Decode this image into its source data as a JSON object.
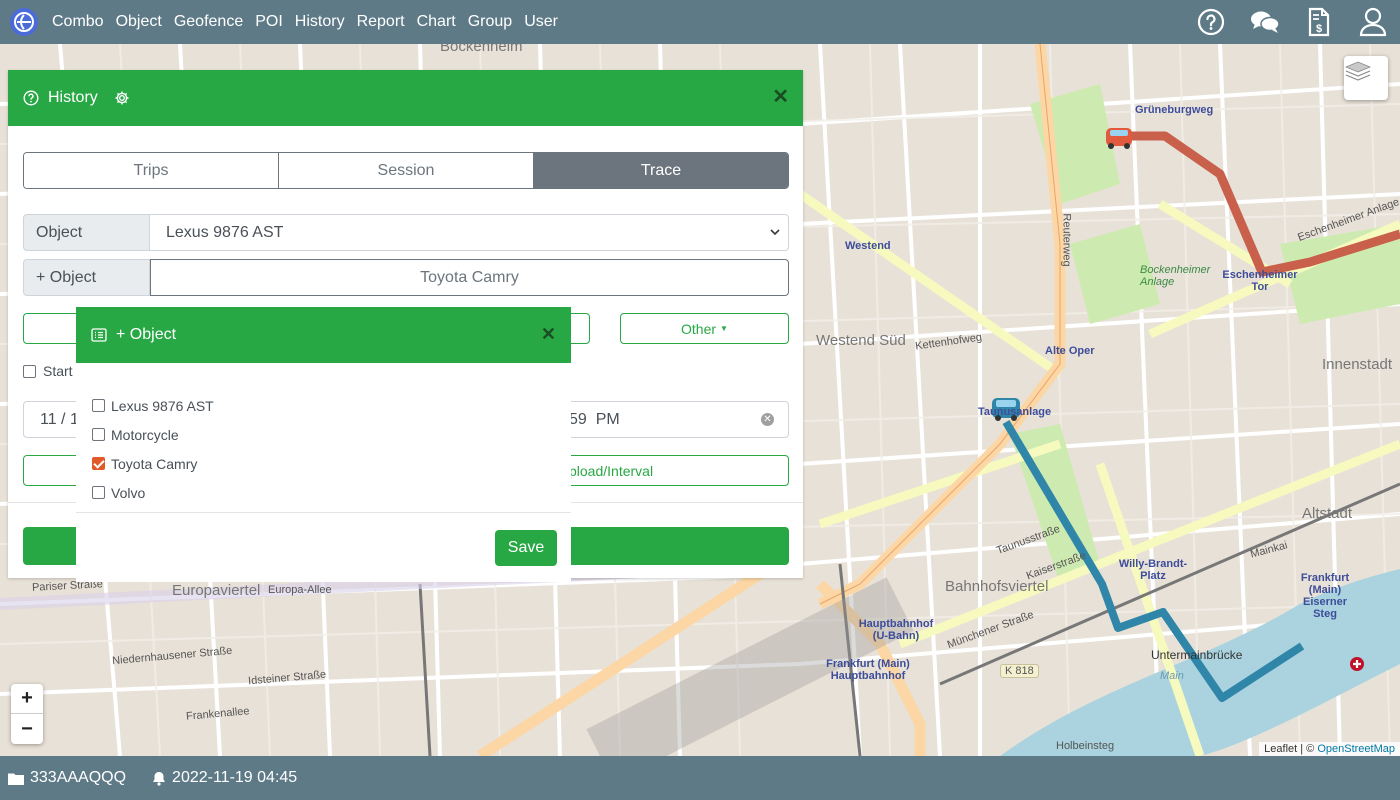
{
  "nav": {
    "items": [
      "Combo",
      "Object",
      "Geofence",
      "POI",
      "History",
      "Report",
      "Chart",
      "Group",
      "User"
    ],
    "icons": [
      "help-icon",
      "chat-icon",
      "invoice-icon",
      "user-icon"
    ]
  },
  "history_panel": {
    "title": "History",
    "tabs": [
      {
        "label": "Trips",
        "active": false
      },
      {
        "label": "Session",
        "active": false
      },
      {
        "label": "Trace",
        "active": true
      }
    ],
    "object_label": "Object",
    "object_value": "Lexus 9876 AST",
    "add_object_label": "+ Object",
    "add_object_value": "Toyota Camry",
    "other_button": "Other",
    "start_label": "Start",
    "start_date_partial": "11 / 1",
    "end_time_partial": "59  PM",
    "interval_button_partial": "pload/Interval"
  },
  "object_modal": {
    "title": "+ Object",
    "items": [
      {
        "label": "Lexus 9876 AST",
        "checked": false
      },
      {
        "label": "Motorcycle",
        "checked": false
      },
      {
        "label": "Toyota Camry",
        "checked": true
      },
      {
        "label": "Volvo",
        "checked": false
      }
    ],
    "save_label": "Save"
  },
  "map": {
    "zoom_in": "+",
    "zoom_out": "−",
    "attribution_prefix": "Leaflet | © ",
    "attribution_link": "OpenStreetMap",
    "track_colors": {
      "red_track": "#c9604c",
      "blue_track": "#2f86a8"
    },
    "labels": {
      "bockenheim": "Bockenheim",
      "westend": "Westend",
      "westend_sued": "Westend Süd",
      "alte_oper": "Alte Oper",
      "grueneburgweg": "Grüneburgweg",
      "eschenheimer_tor": "Eschenheimer Tor",
      "eschenheimer_anlage": "Eschenheimer Anlage",
      "bockenheimer_anlage": "Bockenheimer Anlage",
      "innenstadt": "Innenstadt",
      "altstadt": "Altstadt",
      "taunusanlage": "Taunusanlage",
      "taunusstrasse": "Taunusstraße",
      "willy_brandt": "Willy-Brandt-Platz",
      "bahnhofsviertel": "Bahnhofsviertel",
      "hauptbahnhof_ubahn": "Hauptbahnhof (U-Bahn)",
      "frankfurt_hbf": "Frankfurt (Main) Hauptbahnhof",
      "untermainbruecke": "Untermainbrücke",
      "main": "Main",
      "eiserner_steg": "Frankfurt (Main) Eiserner Steg",
      "europaviertel": "Europaviertel",
      "europa_allee": "Europa-Allee",
      "k818": "K 818",
      "reuterweg": "Reuterweg",
      "kettenhofweg": "Kettenhofweg",
      "niedernhausener": "Niedernhausener Straße",
      "idsteiner": "Idsteiner Straße",
      "frankenallee": "Frankenallee",
      "mainkai": "Mainkai",
      "muenchener": "Münchener Straße",
      "kaiserstrasse": "Kaiserstraße",
      "holbeinsteg": "Holbeinsteg",
      "pariser": "Pariser Straße"
    }
  },
  "footer": {
    "device_id": "333AAAQQQ",
    "timestamp": "2022-11-19 04:45"
  }
}
